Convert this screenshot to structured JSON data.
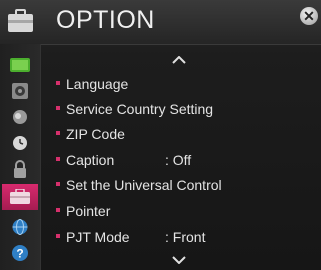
{
  "header": {
    "title": "OPTION",
    "close_glyph": "✕"
  },
  "sidebar": {
    "items": [
      {
        "icon": "picture-icon",
        "color": "#4caf2e",
        "active": false
      },
      {
        "icon": "sound-icon",
        "color": "#6e6e6e",
        "active": false
      },
      {
        "icon": "channel-icon",
        "color": "#6e6e6e",
        "active": false
      },
      {
        "icon": "time-icon",
        "color": "#6e6e6e",
        "active": false
      },
      {
        "icon": "lock-icon",
        "color": "#6e6e6e",
        "active": false
      },
      {
        "icon": "option-icon",
        "color": "#c72560",
        "active": true
      },
      {
        "icon": "network-icon",
        "color": "#2f7fc5",
        "active": false
      },
      {
        "icon": "support-icon",
        "color": "#2f7fc5",
        "active": false
      }
    ]
  },
  "menu": {
    "items": [
      {
        "label": "Language",
        "value": ""
      },
      {
        "label": "Service Country Setting",
        "value": ""
      },
      {
        "label": "ZIP Code",
        "value": ""
      },
      {
        "label": "Caption",
        "value": ": Off"
      },
      {
        "label": "Set the Universal Control",
        "value": ""
      },
      {
        "label": "Pointer",
        "value": ""
      },
      {
        "label": "PJT Mode",
        "value": ": Front"
      }
    ]
  },
  "colors": {
    "accent": "#d6306c"
  }
}
